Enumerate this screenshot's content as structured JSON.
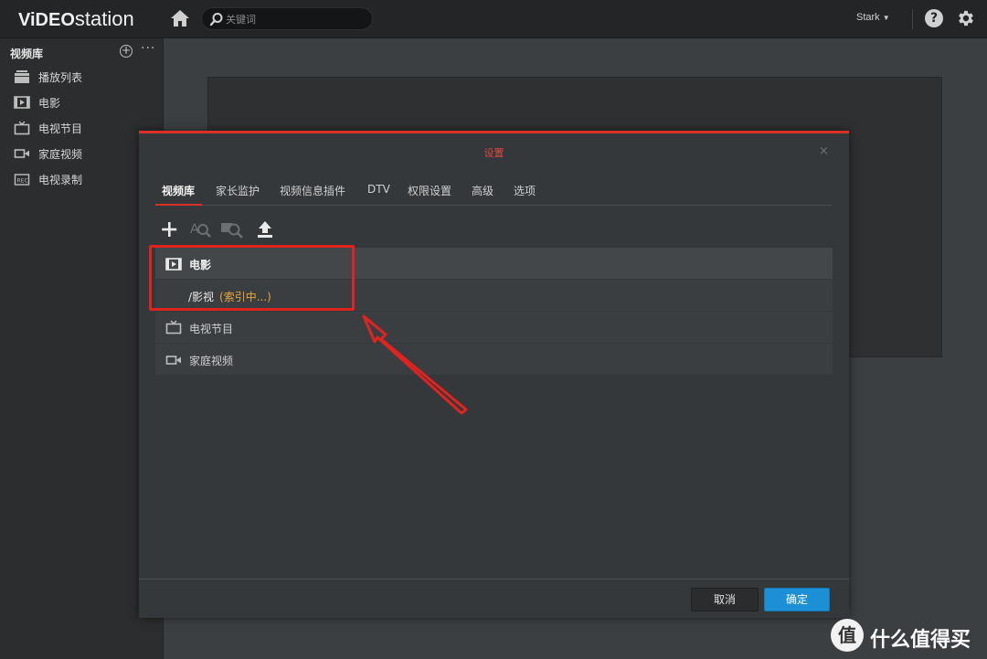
{
  "app": {
    "logo": {
      "part1": "ViDEO",
      "part2": "station"
    },
    "search": {
      "placeholder": "关键词"
    },
    "user": "Stark",
    "help_glyph": "?"
  },
  "sidebar": {
    "title": "视频库",
    "add_glyph": "+",
    "more_glyph": "···",
    "items": [
      {
        "label": "播放列表",
        "icon": "playlist-icon"
      },
      {
        "label": "电影",
        "icon": "film-icon"
      },
      {
        "label": "电视节目",
        "icon": "tv-icon"
      },
      {
        "label": "家庭视频",
        "icon": "camera-icon"
      },
      {
        "label": "电视录制",
        "icon": "rec-icon"
      }
    ]
  },
  "dialog": {
    "title": "设置",
    "close_glyph": "×",
    "tabs": [
      {
        "label": "视频库",
        "active": true
      },
      {
        "label": "家长监护"
      },
      {
        "label": "视频信息插件"
      },
      {
        "label": "DTV"
      },
      {
        "label": "权限设置"
      },
      {
        "label": "高级"
      },
      {
        "label": "选项"
      }
    ],
    "toolbar": [
      "add-icon",
      "search-text-icon",
      "search-image-icon",
      "upload-icon"
    ],
    "library": [
      {
        "label": "电影",
        "icon": "film-icon",
        "expanded": true
      },
      {
        "path": "/影视",
        "status": "(索引中...)"
      },
      {
        "label": "电视节目",
        "icon": "tv-icon"
      },
      {
        "label": "家庭视频",
        "icon": "camera-icon"
      }
    ],
    "buttons": {
      "cancel": "取消",
      "ok": "确定"
    }
  },
  "watermark": {
    "badge": "值",
    "text": "什么值得买"
  },
  "colors": {
    "accent_red": "#d9302a",
    "primary_blue": "#1d8fd6",
    "status_orange": "#e6a53c"
  }
}
